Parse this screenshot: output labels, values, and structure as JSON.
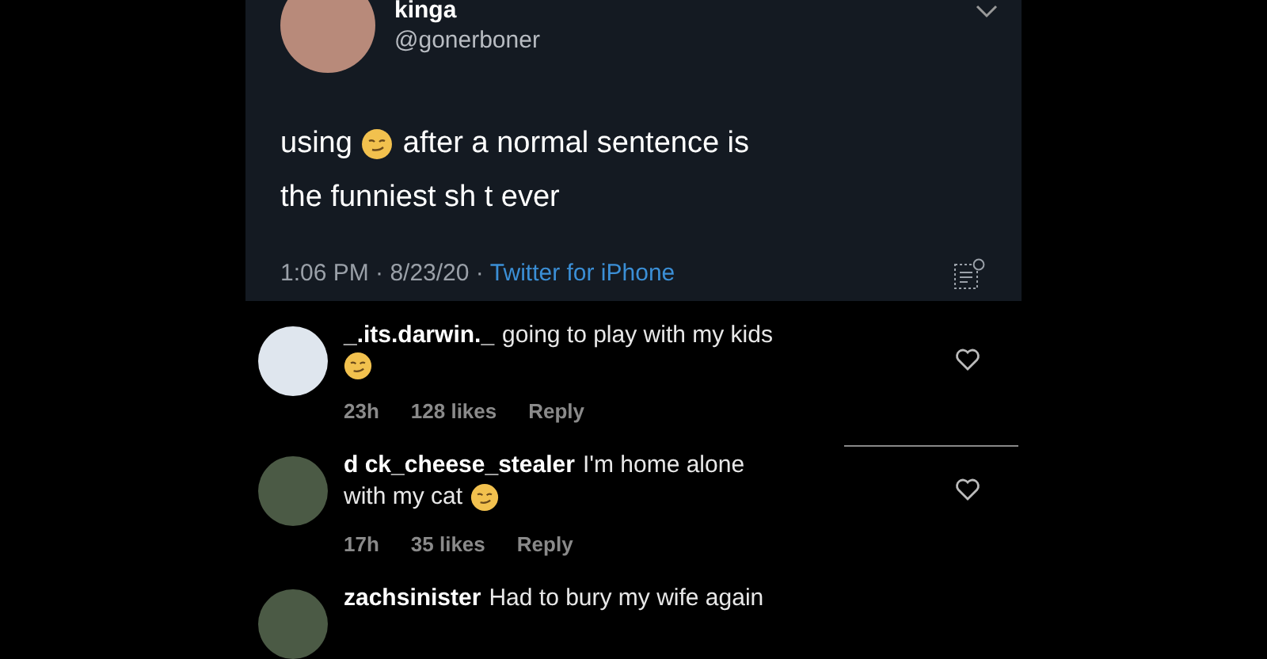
{
  "tweet": {
    "name": "kinga",
    "handle": "@gonerboner",
    "text_before": "using",
    "text_after": "after a normal sentence is",
    "text_line2": "the funniest sh t ever",
    "time": "1:06 PM · 8/23/20 ·",
    "source": "Twitter for iPhone"
  },
  "comments": [
    {
      "kind": "emojiline",
      "username": "_.its.darwin._",
      "text": "going to play with my kids",
      "age": "23h",
      "likes": "128 likes",
      "reply": "Reply"
    },
    {
      "kind": "emojiinline",
      "username": "d ck_cheese_stealer",
      "text": "I'm home alone",
      "text_line2": "with my cat",
      "age": "17h",
      "likes": "35 likes",
      "reply": "Reply"
    },
    {
      "kind": "plain",
      "username": "zachsinister",
      "text": "Had to bury my wife again"
    }
  ]
}
